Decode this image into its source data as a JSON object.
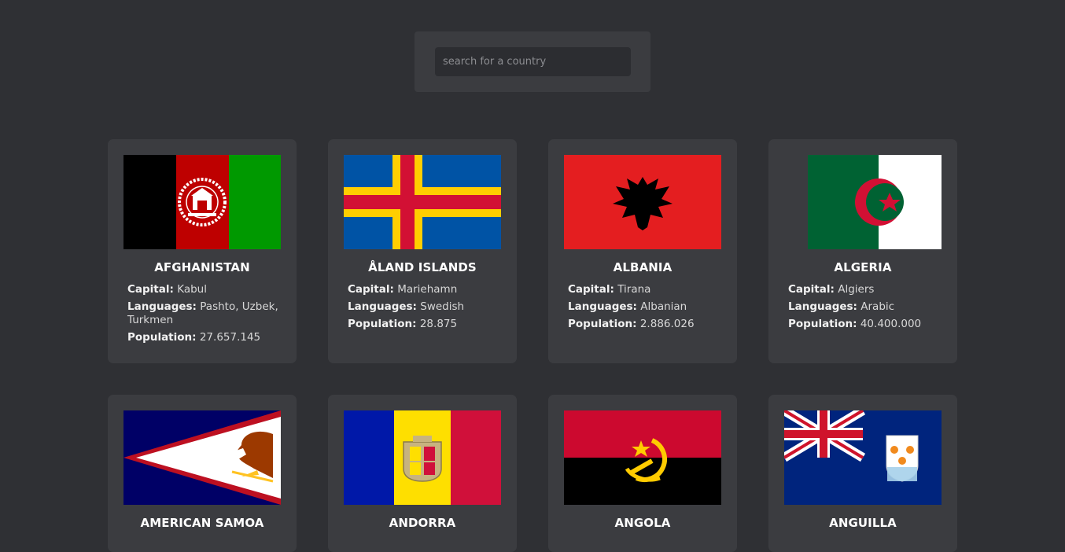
{
  "search": {
    "placeholder": "search for a country"
  },
  "labels": {
    "capital": "Capital:",
    "languages": "Languages:",
    "population": "Population:"
  },
  "countries": [
    {
      "name": "AFGHANISTAN",
      "capital": "Kabul",
      "languages": "Pashto, Uzbek, Turkmen",
      "population": "27.657.145",
      "flag": "afghanistan-flag"
    },
    {
      "name": "ÅLAND ISLANDS",
      "capital": "Mariehamn",
      "languages": "Swedish",
      "population": "28.875",
      "flag": "aland-islands-flag"
    },
    {
      "name": "ALBANIA",
      "capital": "Tirana",
      "languages": "Albanian",
      "population": "2.886.026",
      "flag": "albania-flag"
    },
    {
      "name": "ALGERIA",
      "capital": "Algiers",
      "languages": "Arabic",
      "population": "40.400.000",
      "flag": "algeria-flag"
    },
    {
      "name": "AMERICAN SAMOA",
      "flag": "american-samoa-flag"
    },
    {
      "name": "ANDORRA",
      "flag": "andorra-flag"
    },
    {
      "name": "ANGOLA",
      "flag": "angola-flag"
    },
    {
      "name": "ANGUILLA",
      "flag": "anguilla-flag"
    }
  ]
}
